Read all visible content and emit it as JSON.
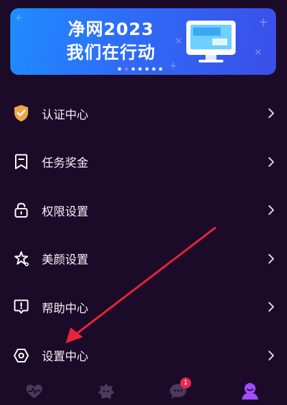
{
  "banner": {
    "line1": "净网2023",
    "line2": "我们在行动",
    "slide_count": 7,
    "active_slide": 2
  },
  "menu": [
    {
      "label": "认证中心",
      "icon": "shield-check-icon"
    },
    {
      "label": "任务奖金",
      "icon": "bookmark-icon"
    },
    {
      "label": "权限设置",
      "icon": "lock-icon"
    },
    {
      "label": "美颜设置",
      "icon": "beauty-sparkle-icon"
    },
    {
      "label": "帮助中心",
      "icon": "help-bubble-icon"
    },
    {
      "label": "设置中心",
      "icon": "settings-hexagon-icon"
    }
  ],
  "tabbar": {
    "tabs": [
      {
        "icon": "heart-pulse-icon"
      },
      {
        "icon": "star-face-icon"
      },
      {
        "icon": "chat-bubble-icon",
        "badge": "1"
      },
      {
        "icon": "profile-icon"
      }
    ],
    "active_tab": 3
  },
  "colors": {
    "background": "#1c0b28",
    "accent": "#a24bff",
    "badge": "#e8294a",
    "arrow": "#e8233a"
  }
}
